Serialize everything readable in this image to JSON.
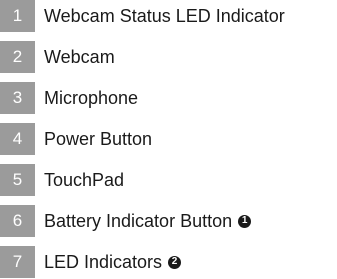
{
  "legend": {
    "items": [
      {
        "number": "1",
        "label": "Webcam Status LED Indicator",
        "note": ""
      },
      {
        "number": "2",
        "label": "Webcam",
        "note": ""
      },
      {
        "number": "3",
        "label": "Microphone",
        "note": ""
      },
      {
        "number": "4",
        "label": "Power Button",
        "note": ""
      },
      {
        "number": "5",
        "label": "TouchPad",
        "note": ""
      },
      {
        "number": "6",
        "label": "Battery Indicator Button",
        "note": "1"
      },
      {
        "number": "7",
        "label": "LED Indicators",
        "note": "2"
      }
    ]
  }
}
